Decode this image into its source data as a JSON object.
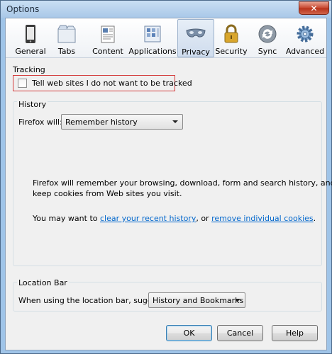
{
  "window": {
    "title": "Options",
    "close_glyph": "✕"
  },
  "toolbar": {
    "items": [
      {
        "label": "General",
        "icon": "general-icon"
      },
      {
        "label": "Tabs",
        "icon": "tabs-icon"
      },
      {
        "label": "Content",
        "icon": "content-icon"
      },
      {
        "label": "Applications",
        "icon": "applications-icon"
      },
      {
        "label": "Privacy",
        "icon": "privacy-mask-icon",
        "selected": true
      },
      {
        "label": "Security",
        "icon": "padlock-icon"
      },
      {
        "label": "Sync",
        "icon": "sync-icon"
      },
      {
        "label": "Advanced",
        "icon": "gear-icon"
      }
    ]
  },
  "tracking": {
    "legend": "Tracking",
    "checkbox_label": "Tell web sites I do not want to be tracked",
    "checked": false
  },
  "history": {
    "legend": "History",
    "firefox_will_label": "Firefox will:",
    "select_value": "Remember history",
    "description": "Firefox will remember your browsing, download, form and search history, and",
    "description_line2": "keep cookies from Web sites you visit.",
    "may_want": "You may want to",
    "clear_link": "clear your recent history",
    "or_text": ", or",
    "remove_link": "remove individual cookies",
    "period": "."
  },
  "location_bar": {
    "legend": "Location Bar",
    "suggest_label": "When using the location bar, suggest:",
    "select_value": "History and Bookmarks"
  },
  "buttons": {
    "ok": "OK",
    "cancel": "Cancel",
    "help": "Help"
  }
}
